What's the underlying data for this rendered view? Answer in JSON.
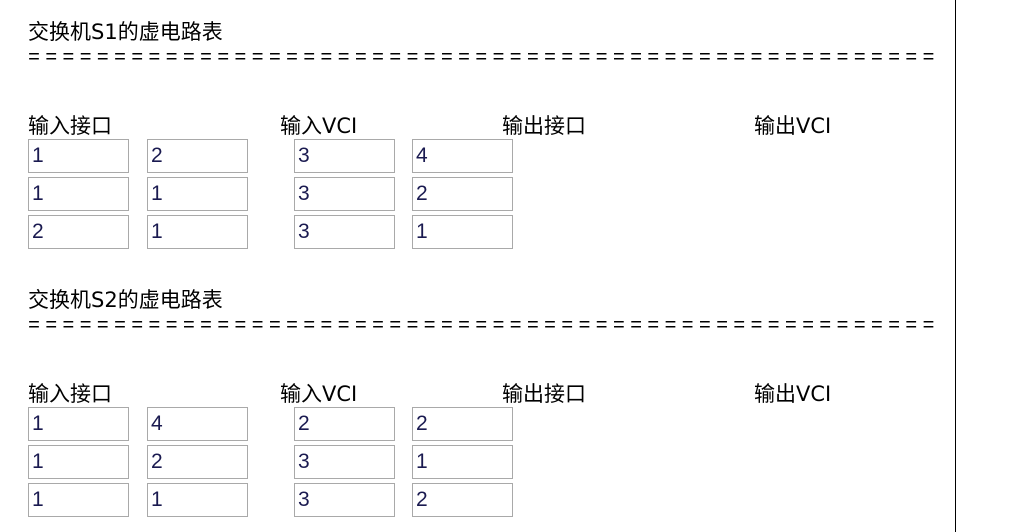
{
  "separator": "=====================================================",
  "tables": [
    {
      "title": "交换机S1的虚电路表",
      "headers": [
        "输入接口",
        "输入VCI",
        "输出接口",
        "输出VCI"
      ],
      "rows": [
        [
          "1",
          "2",
          "3",
          "4"
        ],
        [
          "1",
          "1",
          "3",
          "2"
        ],
        [
          "2",
          "1",
          "3",
          "1"
        ]
      ]
    },
    {
      "title": "交换机S2的虚电路表",
      "headers": [
        "输入接口",
        "输入VCI",
        "输出接口",
        "输出VCI"
      ],
      "rows": [
        [
          "1",
          "4",
          "2",
          "2"
        ],
        [
          "1",
          "2",
          "3",
          "1"
        ],
        [
          "1",
          "1",
          "3",
          "2"
        ]
      ]
    }
  ]
}
